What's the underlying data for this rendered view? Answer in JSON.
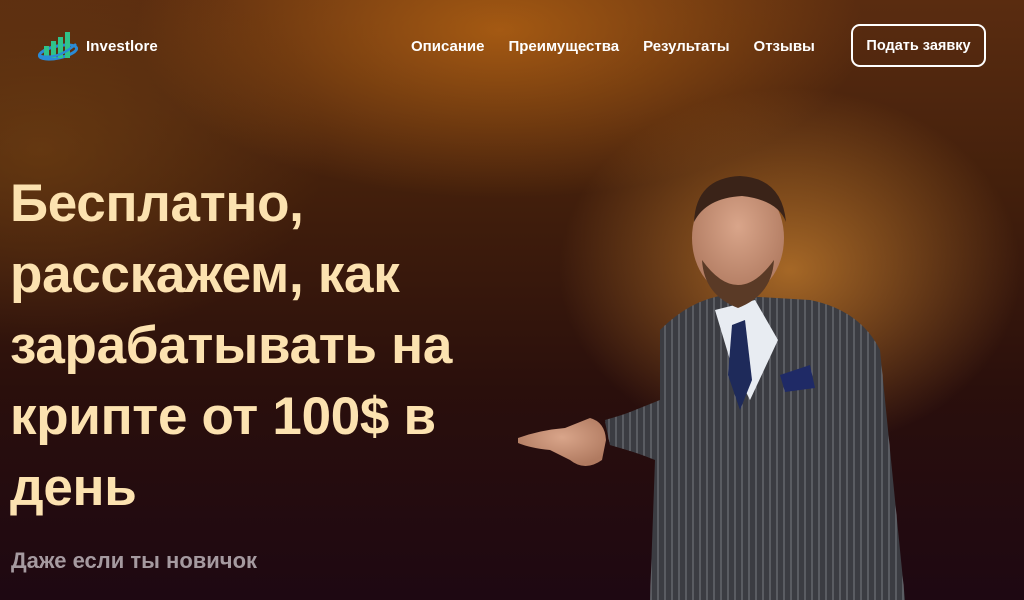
{
  "brand": {
    "name": "Investlore",
    "logo_icon": "bar-chart-globe-logo",
    "colors": {
      "bars": "#2fc38a",
      "ring": "#2a8bd6"
    }
  },
  "nav": {
    "items": [
      {
        "label": "Описание"
      },
      {
        "label": "Преимущества"
      },
      {
        "label": "Результаты"
      },
      {
        "label": "Отзывы"
      }
    ],
    "cta_label": "Подать заявку"
  },
  "hero": {
    "title": "Бесплатно, расскажем, как зарабатывать на крипте от 100$ в день",
    "subtitle": "Даже если ты новичок",
    "title_color": "#fce2b0",
    "subtitle_color": "#a59aa0"
  },
  "colors": {
    "background_top": "#5a2c10",
    "background_bottom": "#1e0812",
    "glow": "#ffa83c"
  }
}
